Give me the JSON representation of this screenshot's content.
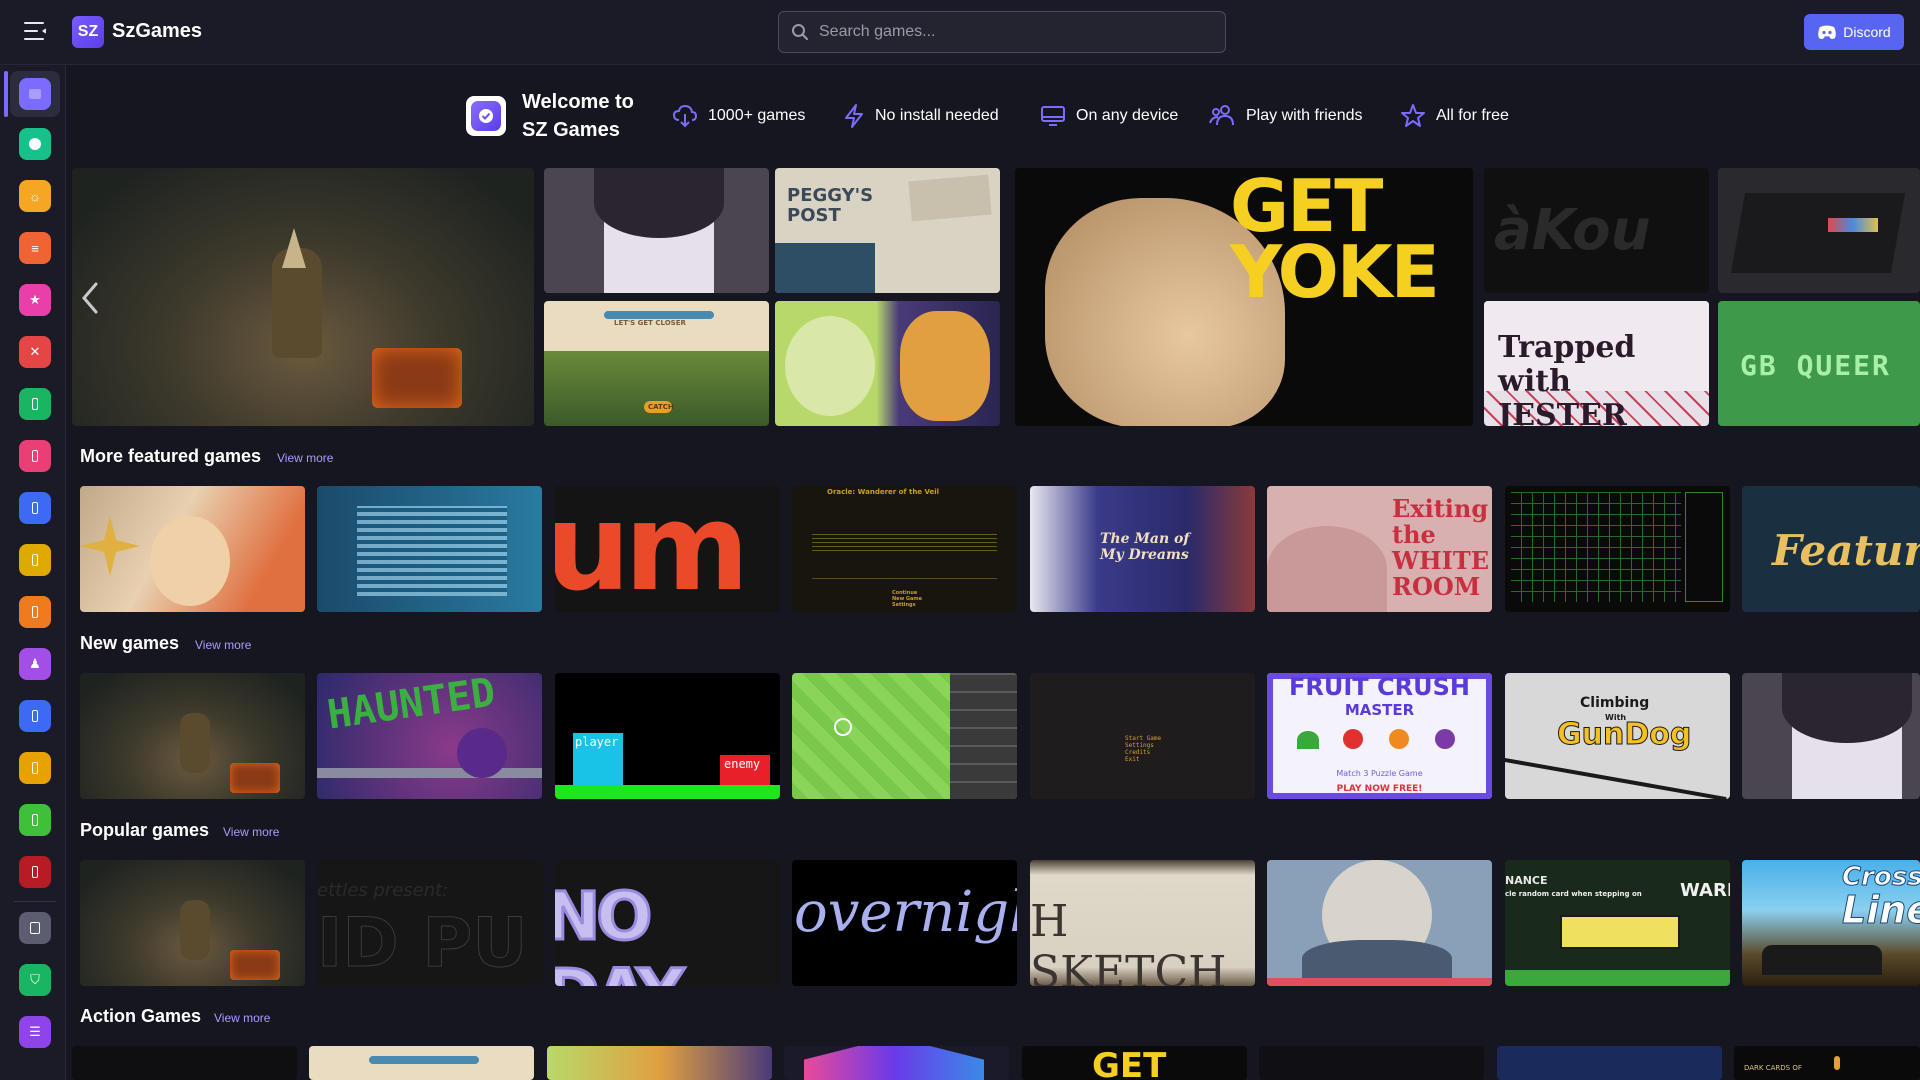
{
  "app": {
    "brand_mark": "SZ",
    "brand_name": "SzGames"
  },
  "search": {
    "placeholder": "Search games..."
  },
  "discord": {
    "label": "Discord"
  },
  "welcome": {
    "title_line1": "Welcome to",
    "title_line2": "SZ Games",
    "features": [
      {
        "icon": "cloud-download-icon",
        "label": "1000+ games"
      },
      {
        "icon": "lightning-icon",
        "label": "No install needed"
      },
      {
        "icon": "monitor-icon",
        "label": "On any device"
      },
      {
        "icon": "people-icon",
        "label": "Play with friends"
      },
      {
        "icon": "star-icon",
        "label": "All for free"
      }
    ]
  },
  "featured_tiles": {
    "peggy": "PEGGY'S POST",
    "get_yoke": "GET YOKE",
    "akou": "àKou",
    "jester": "Trapped with JESTER",
    "gb_queer": "GB QUEER",
    "lets_get_closer": "LET'S GET CLOSER",
    "catch": "CATCH"
  },
  "sections": [
    {
      "title": "More featured games",
      "view_more": "View more"
    },
    {
      "title": "New games",
      "view_more": "View more"
    },
    {
      "title": "Popular games",
      "view_more": "View more"
    },
    {
      "title": "Action Games",
      "view_more": "View more"
    }
  ],
  "more_featured_tiles": {
    "echoes_title": "Oracle: Wanderer of the Veil",
    "echoes_menu": "Continue\nNew Game\nSettings",
    "man_of_dreams": "The Man of My Dreams",
    "white_room": "Exiting the WHITE ROOM",
    "feature": "Feature"
  },
  "new_games_tiles": {
    "haunted": "HAUNTED",
    "player": "player",
    "enemy": "enemy",
    "start_menu": "Start Game\nSettings\nCredits\nExit",
    "fruit_crush": "FRUIT CRUSH",
    "fruit_master": "MASTER",
    "fruit_sub": "Match 3 Puzzle Game",
    "fruit_cta": "PLAY NOW FREE!",
    "climbing": "Climbing",
    "with": "With",
    "gundog": "GunDog"
  },
  "popular_tiles": {
    "presents": "ettles present:",
    "id_pu": "ID PU",
    "no_day": "NO DAY",
    "overnight": "overnight",
    "sketch": "H SKETCH",
    "nance": "NANCE",
    "nance_sub": "cle random card when stepping on",
    "ward": "WARD",
    "crossing": "Crossin",
    "line": "Line"
  },
  "action_tiles": {
    "get": "GET",
    "dark_cards": "DARK CARDS OF"
  },
  "colors": {
    "accent": "#7a6cff",
    "discord": "#5865f2",
    "background": "#15161f"
  }
}
